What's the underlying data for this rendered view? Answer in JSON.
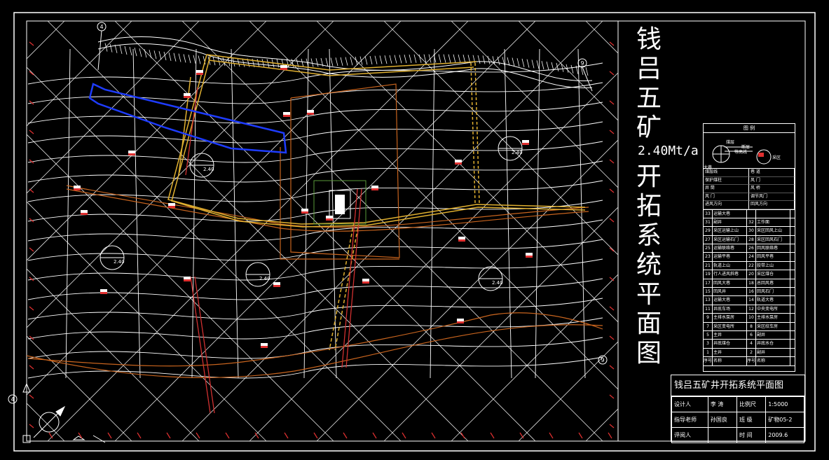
{
  "drawing": {
    "title_chars": [
      "钱",
      "吕",
      "五",
      "矿"
    ],
    "capacity": "2.40Mt/a",
    "title_chars2": [
      "开",
      "拓",
      "系",
      "统",
      "平",
      "面",
      "图"
    ],
    "grid_markers": [
      "4",
      "9",
      "9",
      "4"
    ]
  },
  "title_block": {
    "heading": "钱吕五矿井开拓系统平面图",
    "rows": [
      [
        "设计人",
        "李 涛",
        "比例尺",
        "1:5000"
      ],
      [
        "指导老师",
        "孙国良",
        "班 级",
        "矿物05-2"
      ],
      [
        "评阅人",
        "",
        "时 间",
        "2009.6"
      ]
    ]
  },
  "legend": {
    "heading": "图 例",
    "symbols": [
      "煤层",
      "断层",
      "等高线",
      "采区",
      "大巷"
    ],
    "symbol_pairs": [
      [
        "煤层线",
        "巷 道"
      ],
      [
        "保护煤柱",
        "风 门"
      ],
      [
        "井 筒",
        "风 桥"
      ],
      [
        "风 门",
        "调节风门"
      ],
      [
        "进风方向",
        "回风方向"
      ]
    ],
    "rows": [
      [
        "33",
        "运输大巷",
        "",
        ""
      ],
      [
        "31",
        "副井",
        "32",
        "工作面"
      ],
      [
        "29",
        "采区运输上山",
        "30",
        "采区回风上山"
      ],
      [
        "27",
        "采区运输石门",
        "28",
        "采区回风石门"
      ],
      [
        "25",
        "运输联络巷",
        "26",
        "回风联络巷"
      ],
      [
        "23",
        "运输平巷",
        "24",
        "回风平巷"
      ],
      [
        "21",
        "轨道上山",
        "22",
        "胶带上山"
      ],
      [
        "19",
        "行人进风斜巷",
        "20",
        "采区煤仓"
      ],
      [
        "17",
        "回风大巷",
        "18",
        "总回风巷"
      ],
      [
        "15",
        "回风井",
        "16",
        "回风石门"
      ],
      [
        "13",
        "运输大巷",
        "14",
        "轨道大巷"
      ],
      [
        "11",
        "井底车场",
        "12",
        "中央变电所"
      ],
      [
        "9",
        "主排水泵房",
        "10",
        "主排水泵房"
      ],
      [
        "7",
        "采区变电所",
        "8",
        "采区绞车房"
      ],
      [
        "5",
        "主井",
        "6",
        "副井"
      ],
      [
        "3",
        "井底煤仓",
        "4",
        "井底水仓"
      ],
      [
        "1",
        "主井",
        "2",
        "副井"
      ],
      [
        "序号",
        "名称",
        "序号",
        "名称"
      ]
    ]
  },
  "panel_labels": [
    "2.40",
    "2.40",
    "2.40",
    "2.40",
    "2.40"
  ]
}
